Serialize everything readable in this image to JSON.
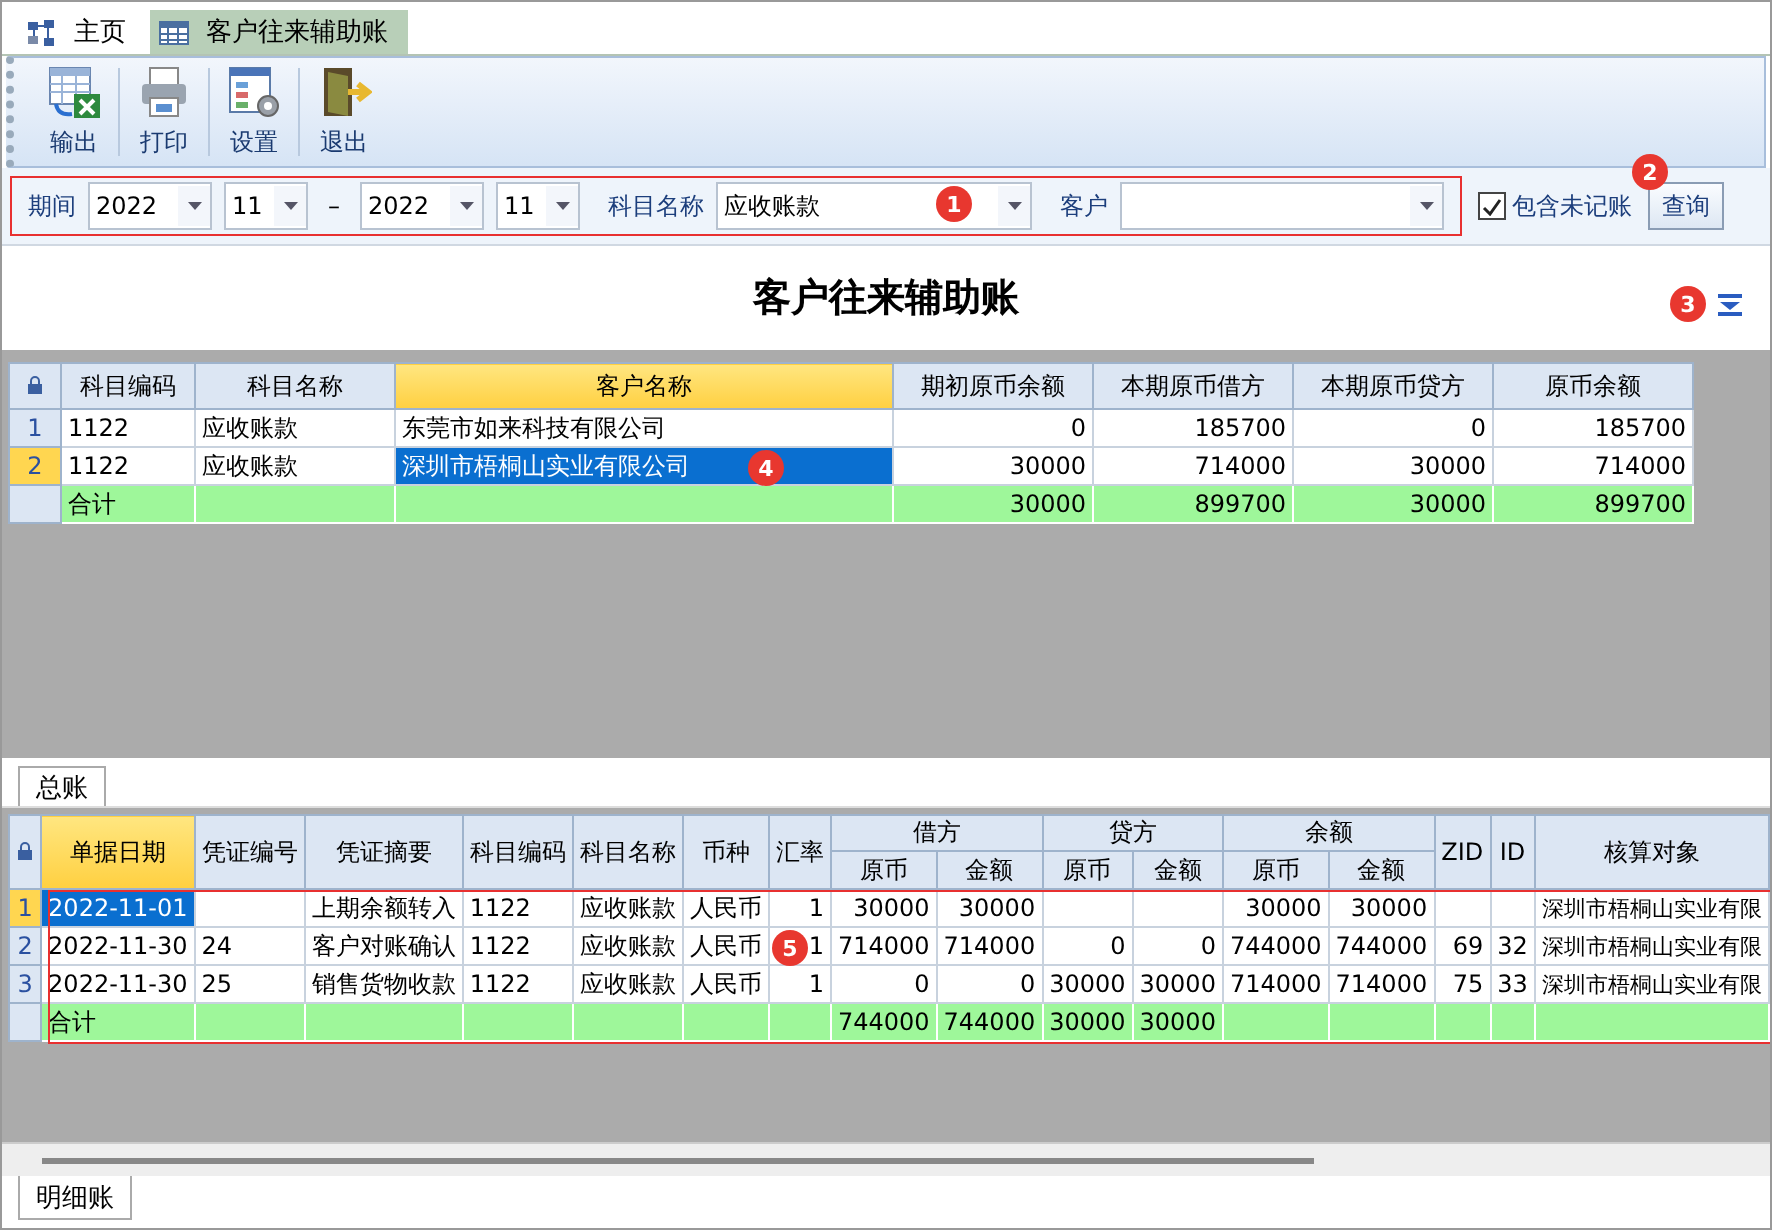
{
  "tabs": [
    {
      "label": "主页",
      "kind": "home",
      "selected": false
    },
    {
      "label": "客户往来辅助账",
      "kind": "table",
      "selected": true
    }
  ],
  "toolbar": [
    {
      "label": "输出",
      "kind": "export"
    },
    {
      "label": "打印",
      "kind": "print"
    },
    {
      "label": "设置",
      "kind": "settings"
    },
    {
      "label": "退出",
      "kind": "exit"
    }
  ],
  "filter": {
    "period_label": "期间",
    "from_year": "2022",
    "from_month": "11",
    "separator": "–",
    "to_year": "2022",
    "to_month": "11",
    "subject_label": "科目名称",
    "subject": "应收账款",
    "customer_label": "客户",
    "include_unposted": {
      "label": "包含未记账",
      "checked": true
    },
    "query_button": "查询"
  },
  "report_title": "客户往来辅助账",
  "markers": [
    "1",
    "2",
    "3",
    "4",
    "5"
  ],
  "summary_table": {
    "columns": [
      {
        "label": "科目编码",
        "selected": false
      },
      {
        "label": "科目名称",
        "selected": false
      },
      {
        "label": "客户名称",
        "selected": true
      },
      {
        "label": "期初原币余额",
        "selected": false
      },
      {
        "label": "本期原币借方",
        "selected": false
      },
      {
        "label": "本期原币贷方",
        "selected": false
      },
      {
        "label": "原币余额",
        "selected": false
      }
    ],
    "rows": [
      {
        "number": "1",
        "selected": false,
        "cells": [
          "1122",
          "应收账款",
          "东莞市如来科技有限公司",
          "0",
          "185700",
          "0",
          "185700"
        ]
      },
      {
        "number": "2",
        "selected": true,
        "cells": [
          "1122",
          "应收账款",
          "深圳市梧桐山实业有限公司",
          "30000",
          "714000",
          "30000",
          "714000"
        ]
      }
    ],
    "total": {
      "label": "合计",
      "cells": [
        null,
        null,
        "30000",
        "899700",
        "30000",
        "899700"
      ]
    }
  },
  "ledger_tab": "总账",
  "detail_table": {
    "columns": [
      {
        "label": "单据日期",
        "selected": true
      },
      {
        "label": "凭证编号",
        "selected": false
      },
      {
        "label": "凭证摘要",
        "selected": false
      },
      {
        "label": "科目编码",
        "selected": false
      },
      {
        "label": "科目名称",
        "selected": false
      },
      {
        "label": "币种",
        "selected": false
      },
      {
        "label": "汇率",
        "selected": false
      },
      {
        "label": "借方",
        "colspan": 2,
        "selected": false,
        "children": [
          "原币",
          "金额"
        ]
      },
      {
        "label": "贷方",
        "colspan": 2,
        "selected": false,
        "children": [
          "原币",
          "金额"
        ]
      },
      {
        "label": "余额",
        "colspan": 2,
        "selected": false,
        "children": [
          "原币",
          "金额"
        ]
      },
      {
        "label": "ZID",
        "selected": false
      },
      {
        "label": "ID",
        "selected": false
      },
      {
        "label": "核算对象",
        "selected": false
      }
    ],
    "rows": [
      {
        "number": "1",
        "selected": true,
        "cells": [
          "2022-11-01",
          null,
          "上期余额转入",
          "1122",
          "应收账款",
          "人民币",
          "1",
          "30000",
          "30000",
          null,
          null,
          "30000",
          "30000",
          null,
          null,
          "深圳市梧桐山实业有限"
        ]
      },
      {
        "number": "2",
        "selected": false,
        "cells": [
          "2022-11-30",
          "24",
          "客户对账确认",
          "1122",
          "应收账款",
          "人民币",
          "1",
          "714000",
          "714000",
          "0",
          "0",
          "744000",
          "744000",
          "69",
          "32",
          "深圳市梧桐山实业有限"
        ]
      },
      {
        "number": "3",
        "selected": false,
        "cells": [
          "2022-11-30",
          "25",
          "销售货物收款",
          "1122",
          "应收账款",
          "人民币",
          "1",
          "0",
          "0",
          "30000",
          "30000",
          "714000",
          "714000",
          "75",
          "33",
          "深圳市梧桐山实业有限"
        ]
      }
    ],
    "total": {
      "label": "合计",
      "cells": [
        null,
        null,
        null,
        null,
        null,
        null,
        "744000",
        "744000",
        "30000",
        "30000",
        null,
        null,
        null,
        null,
        null
      ]
    }
  },
  "bottom_tab": "明细账"
}
